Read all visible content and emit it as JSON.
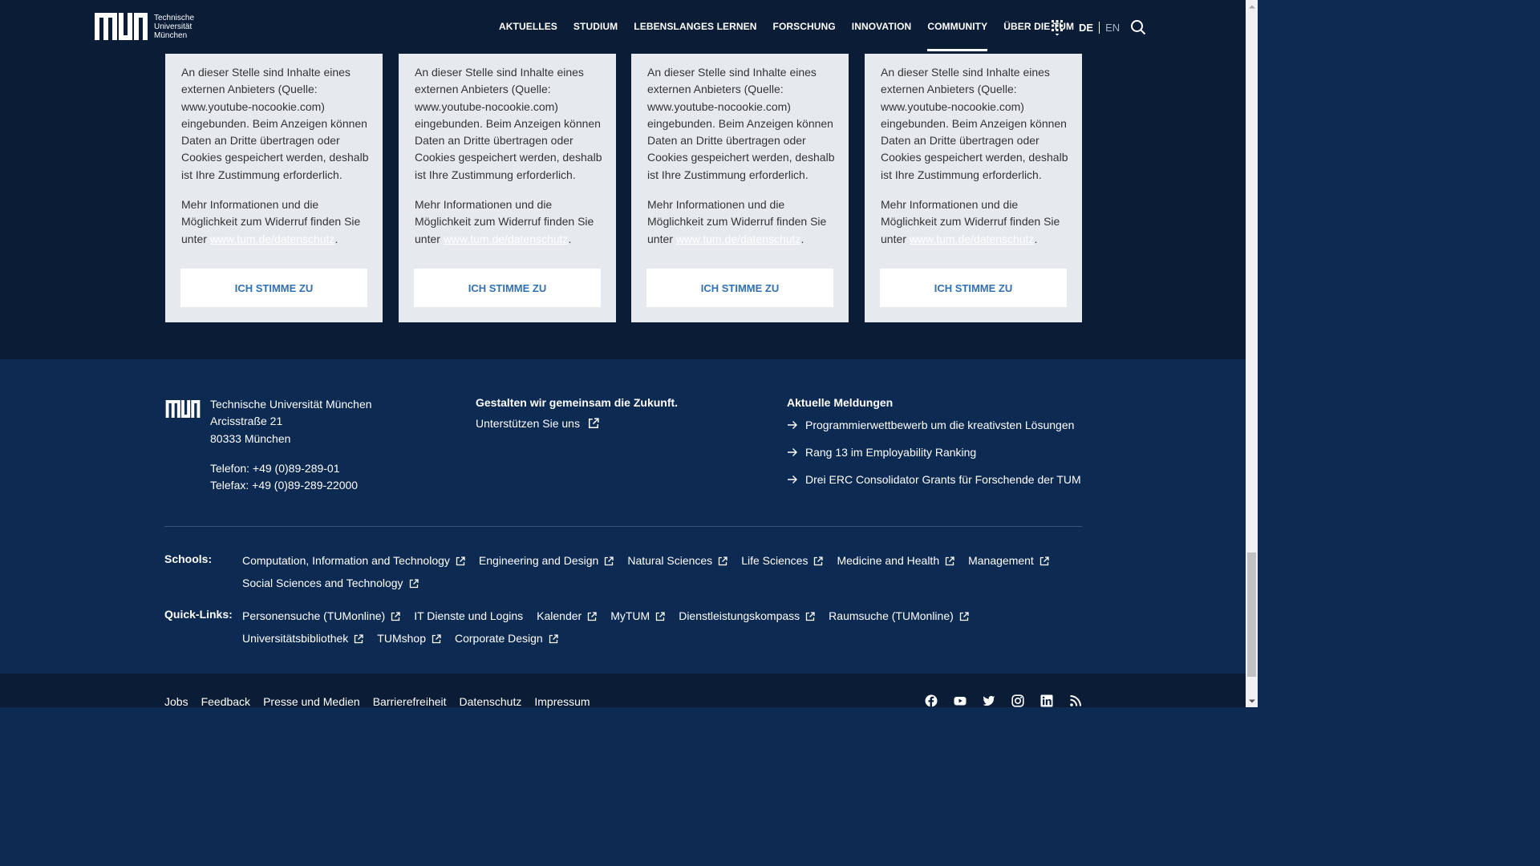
{
  "header": {
    "logo_lines": [
      "Technische",
      "Universität",
      "München"
    ],
    "nav": [
      {
        "label": "AKTUELLES"
      },
      {
        "label": "STUDIUM"
      },
      {
        "label": "LEBENSLANGES LERNEN"
      },
      {
        "label": "FORSCHUNG"
      },
      {
        "label": "INNOVATION"
      },
      {
        "label": "COMMUNITY",
        "active": true
      },
      {
        "label": "ÜBER DIE TUM"
      }
    ],
    "lang_de": "DE",
    "lang_en": "EN",
    "icons": [
      "apps-grid-icon",
      "search-icon"
    ]
  },
  "consent": {
    "text_1": "An dieser Stelle sind Inhalte eines externen Anbieters (Quelle: www.youtube-nocookie.com) eingebunden. Beim Anzeigen können Daten an Dritte übertragen oder Cookies gespeichert werden, deshalb ist Ihre Zustimmung erforderlich.",
    "text_2_prefix": "Mehr Informationen und die Möglichkeit zum Widerruf finden Sie unter ",
    "link": "www.tum.de/datenschutz",
    "text_2_suffix": ".",
    "button": "ICH STIMME ZU",
    "card_count": 4
  },
  "footer": {
    "address": {
      "name": "Technische Universität München",
      "street": "Arcisstraße 21",
      "city": "80333 München",
      "phone": "Telefon: +49 (0)89-289-01",
      "fax": "Telefax: +49 (0)89-289-22000"
    },
    "support_title": "Gestalten wir gemeinsam die Zukunft.",
    "support_link": "Unterstützen Sie uns",
    "news_title": "Aktuelle Meldungen",
    "news": [
      "Programmierwettbewerb um die kreativsten Lösungen",
      "Rang 13 im Employability Ranking",
      "Drei ERC Consolidator Grants für Forschende der TUM"
    ],
    "schools_label": "Schools:",
    "schools": [
      "Computation, Information and Technology",
      "Engineering and Design",
      "Natural Sciences",
      "Life Sciences",
      "Medicine and Health",
      "Management",
      "Social Sciences and Technology"
    ],
    "quicklinks_label": "Quick-Links:",
    "quicklinks": [
      {
        "label": "Personensuche (TUMonline)",
        "external": true
      },
      {
        "label": "IT Dienste und Logins",
        "external": false
      },
      {
        "label": "Kalender",
        "external": true
      },
      {
        "label": "MyTUM",
        "external": true
      },
      {
        "label": "Dienstleistungskompass",
        "external": true
      },
      {
        "label": "Raumsuche (TUMonline)",
        "external": true
      },
      {
        "label": "Universitätsbibliothek",
        "external": true
      },
      {
        "label": "TUMshop",
        "external": true
      },
      {
        "label": "Corporate Design",
        "external": true
      }
    ],
    "bottom_links": [
      "Jobs",
      "Feedback",
      "Presse und Medien",
      "Barrierefreiheit",
      "Datenschutz",
      "Impressum"
    ],
    "social_icons": [
      "facebook-icon",
      "youtube-icon",
      "twitter-icon",
      "instagram-icon",
      "linkedin-icon",
      "rss-icon"
    ]
  },
  "colors": {
    "header_bg": "#0a1c36",
    "footer_bg": "#0d2a52",
    "card_bg": "#e6eaef",
    "accent_blue": "#3070b3"
  }
}
